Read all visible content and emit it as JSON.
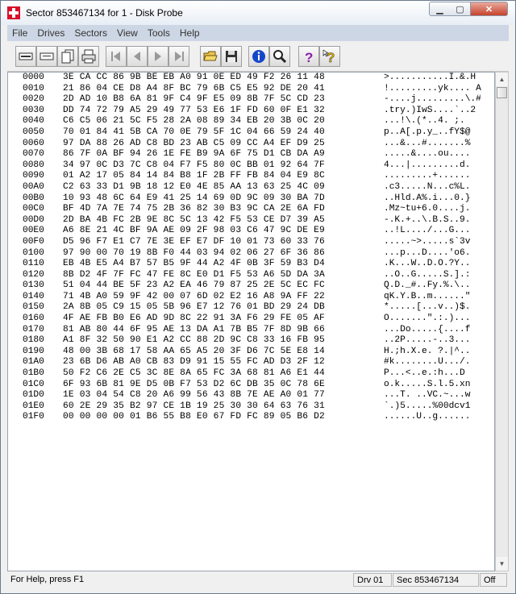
{
  "window": {
    "title": "Sector 853467134 for 1 - Disk Probe"
  },
  "menu": [
    "File",
    "Drives",
    "Sectors",
    "View",
    "Tools",
    "Help"
  ],
  "toolbar": {
    "buttons": [
      {
        "name": "read-button",
        "icon": "drive-card-icon"
      },
      {
        "name": "write-button",
        "icon": "drive-slot-icon"
      },
      {
        "name": "copy-button",
        "icon": "pages-icon"
      },
      {
        "name": "print-button",
        "icon": "printer-icon"
      },
      {
        "name": "first-sector-button",
        "icon": "first-icon"
      },
      {
        "name": "prev-sector-button",
        "icon": "prev-icon"
      },
      {
        "name": "next-sector-button",
        "icon": "next-icon"
      },
      {
        "name": "last-sector-button",
        "icon": "last-icon"
      },
      {
        "name": "open-button",
        "icon": "folder-open-icon"
      },
      {
        "name": "save-button",
        "icon": "floppy-icon"
      },
      {
        "name": "info-button",
        "icon": "info-icon"
      },
      {
        "name": "find-button",
        "icon": "magnifier-icon"
      },
      {
        "name": "help-button",
        "icon": "question-icon"
      },
      {
        "name": "context-help-button",
        "icon": "question-pointer-icon"
      }
    ]
  },
  "hex_rows": [
    {
      "offset": "0000",
      "hex": "3E CA CC 86 9B BE EB A0 91 0E ED 49 F2 26 11 48",
      "ascii": ">...........I.&.H"
    },
    {
      "offset": "0010",
      "hex": "21 86 04 CE D8 A4 8F BC 79 6B C5 E5 92 DE 20 41",
      "ascii": "!.........yk.... A"
    },
    {
      "offset": "0020",
      "hex": "2D AD 10 B8 6A 81 9F C4 9F E5 09 8B 7F 5C CD 23",
      "ascii": "-....j.........\\.#"
    },
    {
      "offset": "0030",
      "hex": "DD 74 72 79 A5 29 49 77 53 E6 1F FD 60 0F E1 32",
      "ascii": ".try.)IwS....`..2"
    },
    {
      "offset": "0040",
      "hex": "C6 C5 06 21 5C F5 28 2A 08 89 34 EB 20 3B 0C 20",
      "ascii": "...!\\.(*..4. ;. "
    },
    {
      "offset": "0050",
      "hex": "70 01 84 41 5B CA 70 0E 79 5F 1C 04 66 59 24 40",
      "ascii": "p..A[.p.y_..fY$@"
    },
    {
      "offset": "0060",
      "hex": "97 DA 88 26 AD C8 BD 23 AB C5 09 CC A4 EF D9 25",
      "ascii": "...&...#.......%"
    },
    {
      "offset": "0070",
      "hex": "86 7F 0A BF 94 26 1E FE B9 9A 6F 75 D1 CB DA A9",
      "ascii": ".....&....ou...."
    },
    {
      "offset": "0080",
      "hex": "34 97 0C D3 7C C8 04 F7 F5 80 0C BB 01 92 64 7F",
      "ascii": "4...|.........d."
    },
    {
      "offset": "0090",
      "hex": "01 A2 17 05 84 14 84 B8 1F 2B FF FB 84 04 E9 8C",
      "ascii": ".........+......"
    },
    {
      "offset": "00A0",
      "hex": "C2 63 33 D1 9B 18 12 E0 4E 85 AA 13 63 25 4C 09",
      "ascii": ".c3.....N...c%L."
    },
    {
      "offset": "00B0",
      "hex": "10 93 48 6C 64 E9 41 25 14 69 0D 9C 09 30 BA 7D",
      "ascii": "..Hld.A%.i...0.}"
    },
    {
      "offset": "00C0",
      "hex": "BF 4D 7A 7E 74 75 2B 36 82 30 B3 9C CA 2E 6A FD",
      "ascii": ".Mz~tu+6.0....j."
    },
    {
      "offset": "00D0",
      "hex": "2D BA 4B FC 2B 9E 8C 5C 13 42 F5 53 CE D7 39 A5",
      "ascii": "-.K.+..\\.B.S..9."
    },
    {
      "offset": "00E0",
      "hex": "A6 8E 21 4C BF 9A AE 09 2F 98 03 C6 47 9C DE E9",
      "ascii": "..!L..../...G..."
    },
    {
      "offset": "00F0",
      "hex": "D5 96 F7 E1 C7 7E 3E EF E7 DF 10 01 73 60 33 76",
      "ascii": ".....~>.....s`3v"
    },
    {
      "offset": "0100",
      "hex": "97 90 00 70 19 8B F0 44 03 94 02 06 27 6F 36 86",
      "ascii": "...p...D....'o6."
    },
    {
      "offset": "0110",
      "hex": "EB 4B E5 A4 B7 57 B5 9F 44 A2 4F 0B 3F 59 B3 D4",
      "ascii": ".K...W..D.O.?Y.."
    },
    {
      "offset": "0120",
      "hex": "8B D2 4F 7F FC 47 FE 8C E0 D1 F5 53 A6 5D DA 3A",
      "ascii": "..O..G.....S.].:"
    },
    {
      "offset": "0130",
      "hex": "51 04 44 BE 5F 23 A2 EA 46 79 87 25 2E 5C EC FC",
      "ascii": "Q.D._#..Fy.%.\\.."
    },
    {
      "offset": "0140",
      "hex": "71 4B A0 59 9F 42 00 07 6D 02 E2 16 A8 9A FF 22",
      "ascii": "qK.Y.B..m......\""
    },
    {
      "offset": "0150",
      "hex": "2A 8B 05 C9 15 05 5B 96 E7 12 76 01 BD 29 24 DB",
      "ascii": "*.....[...v..)$."
    },
    {
      "offset": "0160",
      "hex": "4F AE FB B0 E6 AD 9D 8C 22 91 3A F6 29 FE 05 AF",
      "ascii": "O.......\".:.)..."
    },
    {
      "offset": "0170",
      "hex": "81 AB 80 44 6F 95 AE 13 DA A1 7B B5 7F 8D 9B 66",
      "ascii": "...Do.....{....f"
    },
    {
      "offset": "0180",
      "hex": "A1 8F 32 50 90 E1 A2 CC 88 2D 9C C8 33 16 FB 95",
      "ascii": "..2P.....-..3..."
    },
    {
      "offset": "0190",
      "hex": "48 00 3B 68 17 58 AA 65 A5 20 3F D6 7C 5E E8 14",
      "ascii": "H.;h.X.e. ?.|^.."
    },
    {
      "offset": "01A0",
      "hex": "23 6B D6 AB A0 CB 83 D9 91 15 55 FC AD D3 2F 12",
      "ascii": "#k........U.../."
    },
    {
      "offset": "01B0",
      "hex": "50 F2 C6 2E C5 3C 8E 8A 65 FC 3A 68 81 A6 E1 44",
      "ascii": "P...<..e.:h...D"
    },
    {
      "offset": "01C0",
      "hex": "6F 93 6B 81 9E D5 0B F7 53 D2 6C DB 35 0C 78 6E",
      "ascii": "o.k.....S.l.5.xn"
    },
    {
      "offset": "01D0",
      "hex": "1E 03 04 54 C8 20 A6 99 56 43 8B 7E AE A0 01 77",
      "ascii": "...T. ..VC.~...w"
    },
    {
      "offset": "01E0",
      "hex": "60 2E 29 35 B2 97 CE 1B 19 25 30 30 64 63 76 31",
      "ascii": "`.)5.....%00dcv1"
    },
    {
      "offset": "01F0",
      "hex": "00 00 00 00 01 B6 55 B8 E0 67 FD FC 89 05 B6 D2",
      "ascii": "......U..g......"
    }
  ],
  "status": {
    "help": "For Help, press F1",
    "drive": "Drv  01",
    "sector": "Sec 853467134",
    "mode": "Off"
  }
}
